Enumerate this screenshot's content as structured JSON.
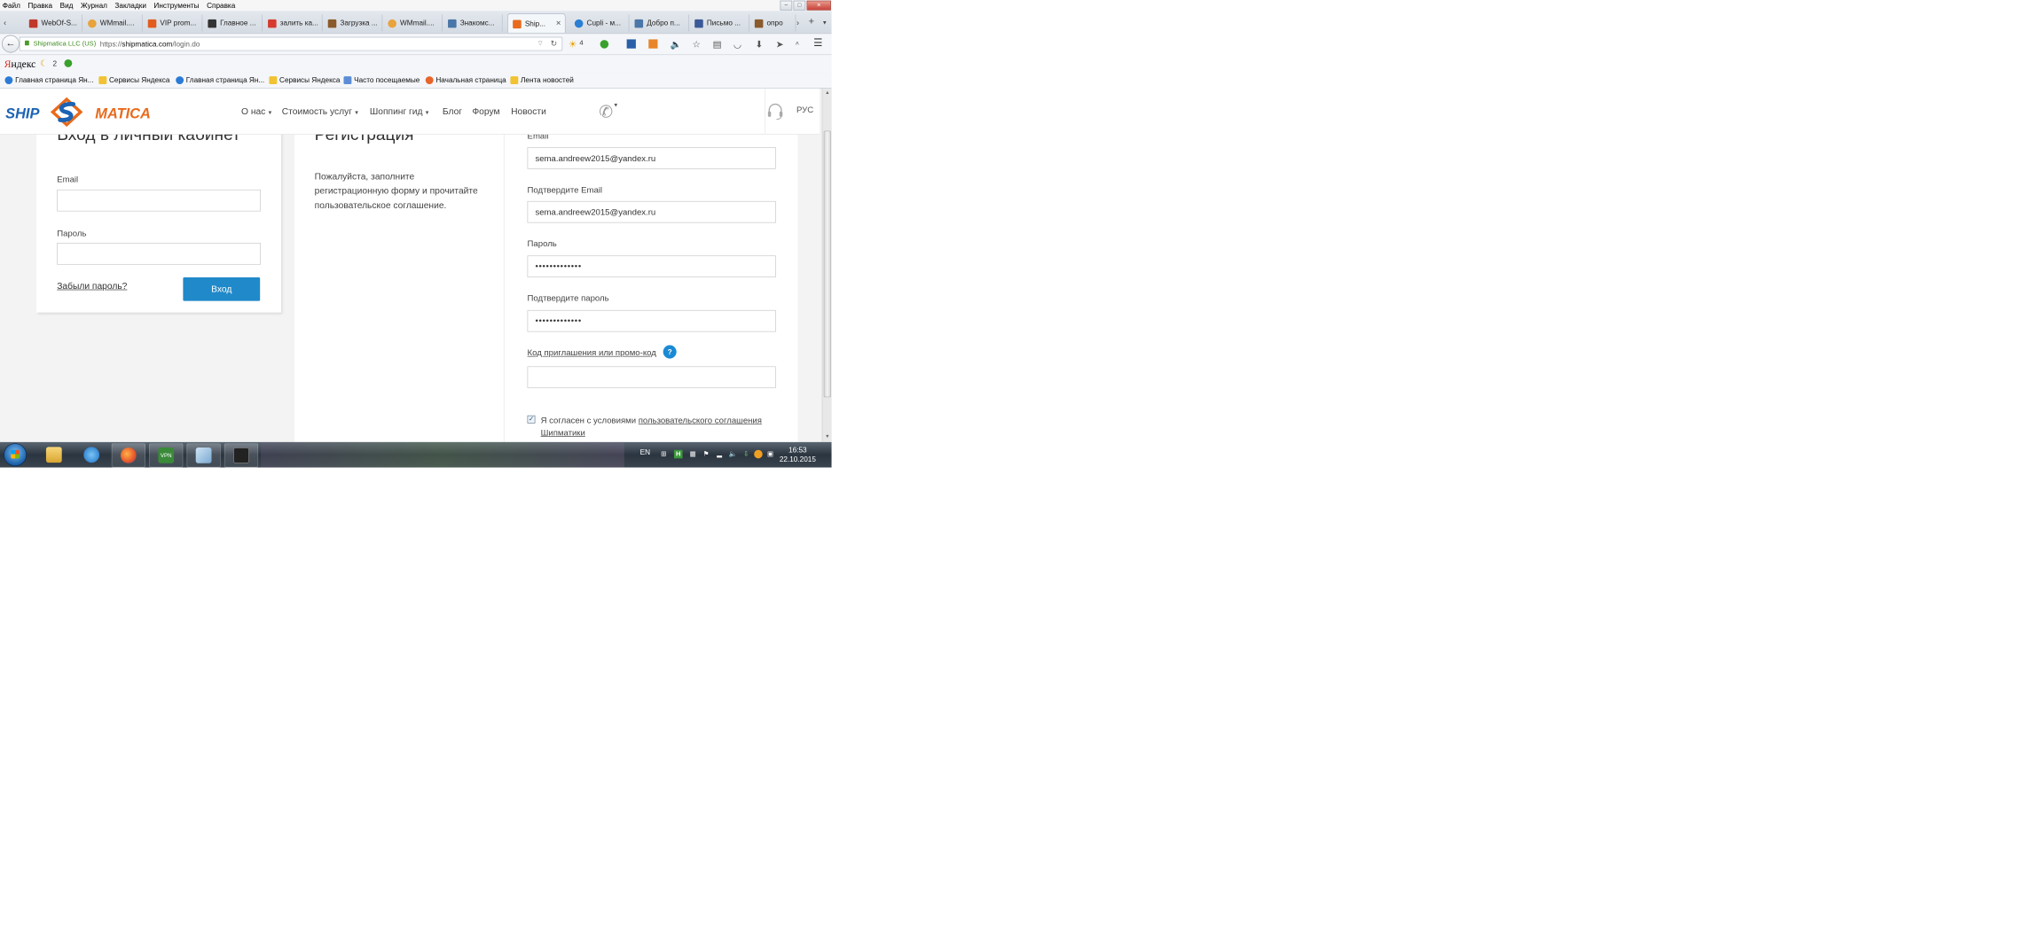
{
  "menubar": {
    "items": [
      "Файл",
      "Правка",
      "Вид",
      "Журнал",
      "Закладки",
      "Инструменты",
      "Справка"
    ]
  },
  "tabs": [
    {
      "label": "WebOf-S...",
      "color": "#c0392b"
    },
    {
      "label": "WMmail....",
      "color": "#e8a33c"
    },
    {
      "label": "VIP prom...",
      "color": "#e25c1e"
    },
    {
      "label": "Главное ...",
      "color": "#333333"
    },
    {
      "label": "залить ка...",
      "color": "#d63b2f"
    },
    {
      "label": "Загрузка ...",
      "color": "#8a5a2b"
    },
    {
      "label": "WMmail....",
      "color": "#e8a33c"
    },
    {
      "label": "Знакомс...",
      "color": "#4a76a8"
    },
    {
      "label": "Ship...",
      "color": "#e86a1c"
    },
    {
      "label": "Cupli - м...",
      "color": "#2a7fd4"
    },
    {
      "label": "Добро п...",
      "color": "#4a76a8"
    },
    {
      "label": "Письмо ...",
      "color": "#3b5998"
    },
    {
      "label": "опро",
      "color": "#8a5a2b"
    }
  ],
  "address": {
    "identity": "Shipmatica LLC (US)",
    "url_prefix": "https://",
    "url_host": "shipmatica.com",
    "url_path": "/login.do"
  },
  "toolbar": {
    "weather": "4"
  },
  "yandex": {
    "logo_first": "Я",
    "logo_rest": "ндекс",
    "moon_count": "2"
  },
  "bookmarks": [
    {
      "label": "Главная страница Ян...",
      "color": "#2b7bd6"
    },
    {
      "label": "Сервисы Яндекса",
      "color": "#f1c232"
    },
    {
      "label": "Главная страница Ян...",
      "color": "#2b7bd6"
    },
    {
      "label": "Сервисы Яндекса",
      "color": "#f1c232"
    },
    {
      "label": "Часто посещаемые",
      "color": "#5c8ed6"
    },
    {
      "label": "Начальная страница",
      "color": "#e8642a"
    },
    {
      "label": "Лента новостей",
      "color": "#f1c232"
    }
  ],
  "site": {
    "logo_left": "SHIP",
    "logo_right": "MATICA",
    "nav": [
      {
        "label": "О нас",
        "dropdown": true
      },
      {
        "label": "Стоимость услуг",
        "dropdown": true
      },
      {
        "label": "Шоппинг гид",
        "dropdown": true
      },
      {
        "label": "Блог",
        "dropdown": false
      },
      {
        "label": "Форум",
        "dropdown": false
      },
      {
        "label": "Новости",
        "dropdown": false
      }
    ],
    "lang": "РУС"
  },
  "login": {
    "title": "Вход в личный кабинет",
    "email_label": "Email",
    "email_value": "",
    "password_label": "Пароль",
    "password_value": "",
    "forgot": "Забыли пароль?",
    "submit": "Вход"
  },
  "register": {
    "title": "Регистрация",
    "description": "Пожалуйста, заполните регистрационную форму и прочитайте пользовательское соглашение.",
    "email_label": "Email",
    "email_value": "sema.andreew2015@yandex.ru",
    "confirm_email_label": "Подтвердите Email",
    "confirm_email_value": "sema.andreew2015@yandex.ru",
    "password_label": "Пароль",
    "password_value": "•••••••••••••",
    "confirm_password_label": "Подтвердите пароль",
    "confirm_password_value": "•••••••••••••",
    "promo_label": "Код приглашения или промо-код",
    "promo_value": "",
    "help": "?",
    "agree_checked": true,
    "agree_text": "Я согласен с условиями ",
    "agree_link": "пользовательского соглашения Шипматики"
  },
  "taskbar": {
    "lang": "EN",
    "vpn": "VPN",
    "time": "16:53",
    "date": "22.10.2015"
  },
  "colors": {
    "primary_button": "#2089c9",
    "logo_blue": "#1c63b3",
    "logo_orange": "#e86a1c"
  }
}
